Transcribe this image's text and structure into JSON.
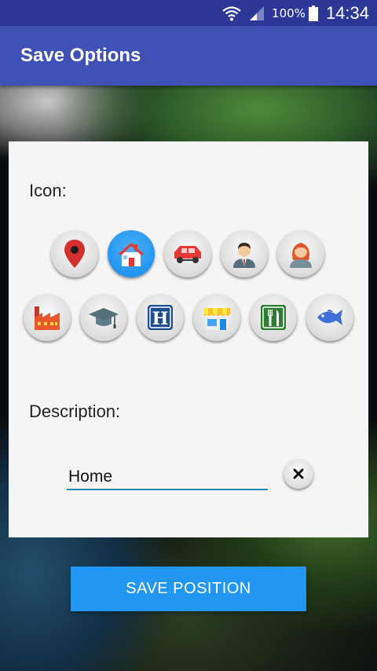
{
  "status_bar": {
    "battery_percent": "100%",
    "time": "14:34"
  },
  "app_bar": {
    "title": "Save Options"
  },
  "form": {
    "icon_label": "Icon:",
    "description_label": "Description:",
    "description_value": "Home",
    "icons": [
      {
        "name": "map-pin-icon",
        "selected": false
      },
      {
        "name": "house-icon",
        "selected": true
      },
      {
        "name": "car-icon",
        "selected": false
      },
      {
        "name": "man-icon",
        "selected": false
      },
      {
        "name": "woman-icon",
        "selected": false
      },
      {
        "name": "factory-icon",
        "selected": false
      },
      {
        "name": "graduation-cap-icon",
        "selected": false
      },
      {
        "name": "hotel-icon",
        "selected": false
      },
      {
        "name": "shop-icon",
        "selected": false
      },
      {
        "name": "restaurant-icon",
        "selected": false
      },
      {
        "name": "fish-icon",
        "selected": false
      }
    ],
    "hotel_letter": "H"
  },
  "save_button": {
    "label": "SAVE POSITION"
  },
  "colors": {
    "status_bar": "#2c3796",
    "app_bar": "#3f51b5",
    "accent": "#2196f3",
    "input_underline": "#1e88a8"
  }
}
